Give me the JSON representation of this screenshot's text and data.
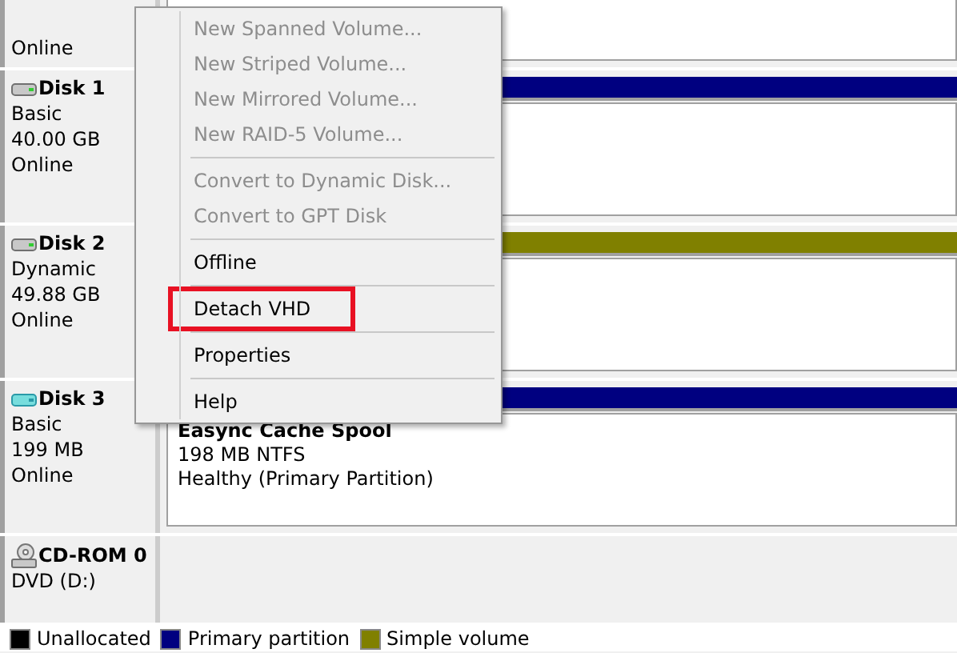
{
  "top_disk": {
    "status": "Online"
  },
  "disks": [
    {
      "name": "Disk 1",
      "type": "Basic",
      "size": "40.00 GB",
      "status": "Online",
      "kind": "hdd",
      "color": "#000080"
    },
    {
      "name": "Disk 2",
      "type": "Dynamic",
      "size": "49.88 GB",
      "status": "Online",
      "kind": "hdd",
      "color": "#808000"
    },
    {
      "name": "Disk 3",
      "type": "Basic",
      "size": "199 MB",
      "status": "Online",
      "kind": "vhd",
      "color": "#000080",
      "volume": {
        "name": "Easync Cache Spool",
        "size": "198 MB NTFS",
        "health": "Healthy (Primary Partition)"
      }
    },
    {
      "name": "CD-ROM 0",
      "type": "DVD (D:)",
      "kind": "cdrom"
    }
  ],
  "context_menu": [
    {
      "label": "New Spanned Volume...",
      "disabled": true,
      "separator_before": false
    },
    {
      "label": "New Striped Volume...",
      "disabled": true,
      "separator_before": false
    },
    {
      "label": "New Mirrored Volume...",
      "disabled": true,
      "separator_before": false
    },
    {
      "label": "New RAID-5 Volume...",
      "disabled": true,
      "separator_before": false
    },
    {
      "label": "Convert to Dynamic Disk...",
      "disabled": true,
      "separator_before": true
    },
    {
      "label": "Convert to GPT Disk",
      "disabled": true,
      "separator_before": false
    },
    {
      "label": "Offline",
      "disabled": false,
      "separator_before": true
    },
    {
      "label": "Detach VHD",
      "disabled": false,
      "separator_before": true,
      "highlighted": true
    },
    {
      "label": "Properties",
      "disabled": false,
      "separator_before": true
    },
    {
      "label": "Help",
      "disabled": false,
      "separator_before": true
    }
  ],
  "legend": [
    {
      "label": "Unallocated",
      "color": "#000000"
    },
    {
      "label": "Primary partition",
      "color": "#000080"
    },
    {
      "label": "Simple volume",
      "color": "#808000"
    }
  ]
}
